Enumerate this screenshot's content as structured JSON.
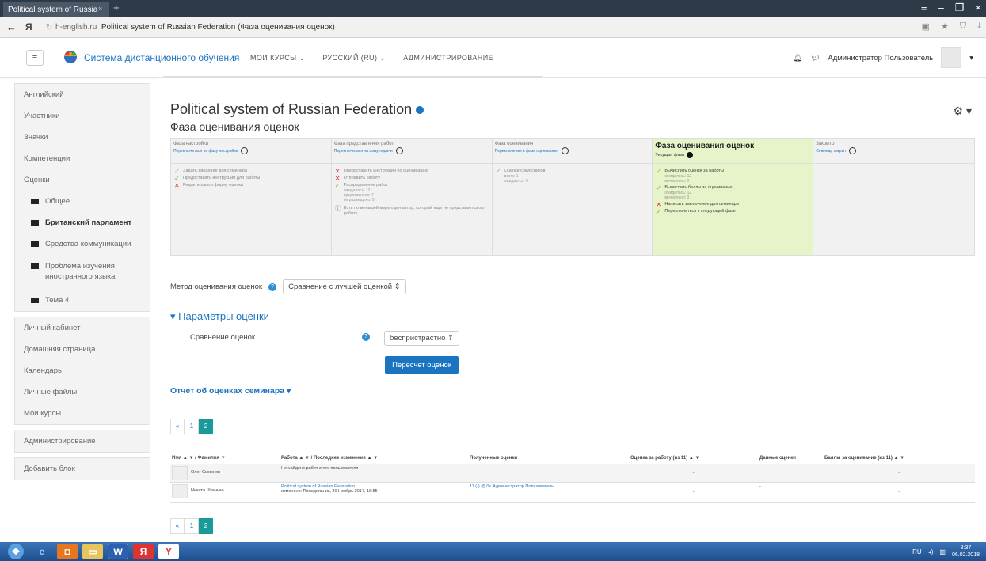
{
  "browser": {
    "tab_title": "Political system of Russia",
    "tab_close": "×",
    "new_tab": "+",
    "yx": "Я",
    "url_domain": "h-english.ru",
    "url_title": "Political system of Russian Federation (Фаза оценивания оценок)"
  },
  "nav": {
    "site_name": "Система дистанционного обучения",
    "menu": [
      "МОИ КУРСЫ ⌄",
      "РУССКИЙ (RU) ⌄",
      "АДМИНИСТРИРОВАНИЕ"
    ],
    "user": "Администратор Пользователь"
  },
  "sidebar": {
    "block1": [
      "Английский",
      "Участники",
      "Значки",
      "Компетенции",
      "Оценки"
    ],
    "sub": [
      "Общее",
      "Британский парламент",
      "Средства коммуникации",
      "Проблема изучения иностранного языка",
      "Тема 4"
    ],
    "block2": [
      "Личный кабинет",
      "Домашняя страница",
      "Календарь",
      "Личные файлы",
      "Мои курсы"
    ],
    "admin": "Администрирование",
    "add_block": "Добавить блок"
  },
  "page": {
    "title": "Political system of Russian Federation",
    "subtitle": "Фаза оценивания оценок"
  },
  "phases": [
    {
      "name": "Фаза настройки",
      "switch": "Переключиться на фазу настройки",
      "tasks": [
        {
          "mark": "ok",
          "text": "Задать введение для семинара"
        },
        {
          "mark": "ok",
          "text": "Предоставить инструкции для работы"
        },
        {
          "mark": "no",
          "text": "Редактировать форму оценки"
        }
      ]
    },
    {
      "name": "Фаза представления работ",
      "switch": "Переключиться на фазу подачи",
      "tasks": [
        {
          "mark": "no",
          "text": "Предоставить инструкции по оцениванию"
        },
        {
          "mark": "no",
          "text": "Отправить работу"
        },
        {
          "mark": "ok",
          "text": "Распределение работ",
          "sub": [
            "ожидалось: 12",
            "представлено: 7",
            "не размещено: 0"
          ]
        },
        {
          "mark": "info",
          "text": "Есть по меньшей мере один автор, который еще не представил свою работу"
        }
      ]
    },
    {
      "name": "Фаза оценивания",
      "switch": "Переключение к фазе оценивания",
      "tasks": [
        {
          "mark": "ok",
          "text": "Оценки сокурсников",
          "sub": [
            "всего: 1",
            "ожидается: 0"
          ]
        }
      ]
    },
    {
      "name": "Фаза оценивания оценок",
      "current": "Текущая фаза",
      "tasks": [
        {
          "mark": "ok",
          "text": "Вычислить оценки за работы",
          "sub": [
            "ожидалось: 12",
            "вычислено: 0"
          ]
        },
        {
          "mark": "ok",
          "text": "Вычислить баллы за оценивание",
          "sub": [
            "ожидалось: 12",
            "вычислено: 0"
          ]
        },
        {
          "mark": "no",
          "text": "Написать заключение для семинара"
        },
        {
          "mark": "ok",
          "text": "Переключиться к следующей фазе"
        }
      ]
    },
    {
      "name": "Закрыто",
      "switch": "Семинар закрыт",
      "tasks": []
    }
  ],
  "method": {
    "label": "Метод оценивания оценок",
    "value": "Сравнение с лучшей оценкой ⇕"
  },
  "params": {
    "header": "Параметры оценки",
    "cmp_label": "Сравнение оценок",
    "cmp_value": "беспристрастно ⇕",
    "recalc": "Пересчет оценок"
  },
  "report": {
    "header": "Отчет об оценках семинара ▾"
  },
  "pager": [
    "«",
    "1",
    "2"
  ],
  "table": {
    "headers": [
      "Имя ▲ ▼ / Фамилия ▼",
      "Работа ▲ ▼ / Последнее изменение ▲ ▼",
      "Полученные оценки",
      "Оценка за работу (из 11) ▲ ▼",
      "Данные оценки",
      "Баллы за оценивание (из 11) ▲ ▼"
    ],
    "rows": [
      {
        "name": "Олег Симонов",
        "work": "Не найдено работ этого пользователя",
        "modified": "",
        "received": "-",
        "grade": "-",
        "given": "",
        "points": "-"
      },
      {
        "name": "Никита Штенько",
        "work": "Political system of Russian Federation",
        "modified": "изменено: Понедельник, 20 Ноябрь 2017, 16:55",
        "received": "11 (-) @ 0<  Администратор Пользователь",
        "grade": "-",
        "given": "-",
        "points": "-"
      }
    ]
  },
  "taskbar": {
    "lang": "RU",
    "time": "8:37",
    "date": "06.02.2018"
  }
}
